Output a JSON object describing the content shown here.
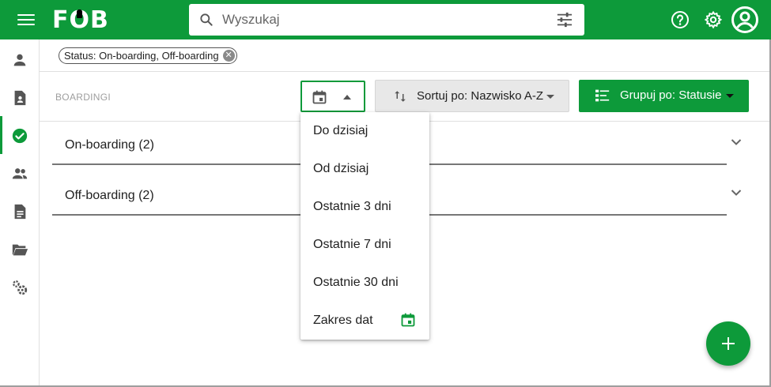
{
  "header": {
    "logo_text": "FOB",
    "search_placeholder": "Wyszukaj",
    "icons": [
      "menu-icon",
      "search-icon",
      "tune-icon",
      "help-icon",
      "gear-icon",
      "account-icon"
    ]
  },
  "sidebar": {
    "items": [
      {
        "name": "person-icon",
        "active": false
      },
      {
        "name": "contact-document-icon",
        "active": false
      },
      {
        "name": "check-circle-icon",
        "active": true
      },
      {
        "name": "people-icon",
        "active": false
      },
      {
        "name": "document-icon",
        "active": false
      },
      {
        "name": "folder-open-icon",
        "active": false
      },
      {
        "name": "settings-cog-icon",
        "active": false
      }
    ]
  },
  "filter": {
    "chip_label": "Status: On-boarding, Off-boarding"
  },
  "toolbar": {
    "title": "BOARDINGI",
    "sort_label": "Sortuj po: Nazwisko A-Z",
    "group_label": "Grupuj po: Statusie"
  },
  "sections": [
    {
      "label": "On-boarding (2)"
    },
    {
      "label": "Off-boarding (2)"
    }
  ],
  "date_menu": {
    "items": [
      {
        "label": "Do dzisiaj"
      },
      {
        "label": "Od dzisiaj"
      },
      {
        "label": "Ostatnie 3 dni"
      },
      {
        "label": "Ostatnie 7 dni"
      },
      {
        "label": "Ostatnie 30 dni"
      },
      {
        "label": "Zakres dat"
      }
    ]
  },
  "colors": {
    "brand_green": "#0d9a3a",
    "text": "#212121",
    "muted": "#9e9e9e"
  }
}
